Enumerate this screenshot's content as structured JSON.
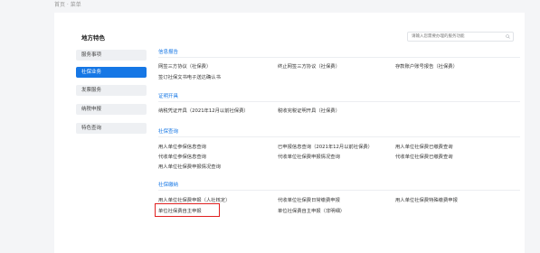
{
  "breadcrumb": {
    "text": "首页 · 菜单"
  },
  "sidebar": {
    "title": "地方特色",
    "items": [
      {
        "label": "服务事项",
        "active": false
      },
      {
        "label": "社保业务",
        "active": true
      },
      {
        "label": "发票服务",
        "active": false
      },
      {
        "label": "纳税申报",
        "active": false
      },
      {
        "label": "特色查询",
        "active": false
      }
    ]
  },
  "search": {
    "placeholder": "请输入您需要办理的服务功能"
  },
  "sections": [
    {
      "title": "信息报告",
      "items": [
        [
          "网签三方协议（社保费）",
          "终止网签三方协议（社保费）",
          "存款账户账号报告（社保费）"
        ],
        [
          "签订社保文书电子送达确认书"
        ]
      ]
    },
    {
      "title": "证明开具",
      "items": [
        [
          "纳税凭证开具（2021年12月以前社保费）",
          "税收完税证明开具（社保费）"
        ]
      ]
    },
    {
      "title": "社保查询",
      "items": [
        [
          "用人单位参保信息查询",
          "已申报信息查询（2021年12月以前社保费）",
          "用人单位社保费已缴费查询"
        ],
        [
          "代收单位参保信息查询",
          "代收单位社保费申报情况查询",
          "代收单位社保费已缴费查询"
        ],
        [
          "用人单位社保费申报情况查询"
        ]
      ]
    },
    {
      "title": "社保缴纳",
      "items": [
        [
          "用人单位社保费申报（人社核定）",
          "代收单位社保费日常缴费申报",
          "用人单位社保费特殊缴费申报"
        ],
        [
          "单位社保费自主申报",
          "单位社保费自主申报（非明细）"
        ]
      ]
    }
  ],
  "highlight": {
    "color": "#e02020",
    "target": "单位社保费自主申报"
  }
}
